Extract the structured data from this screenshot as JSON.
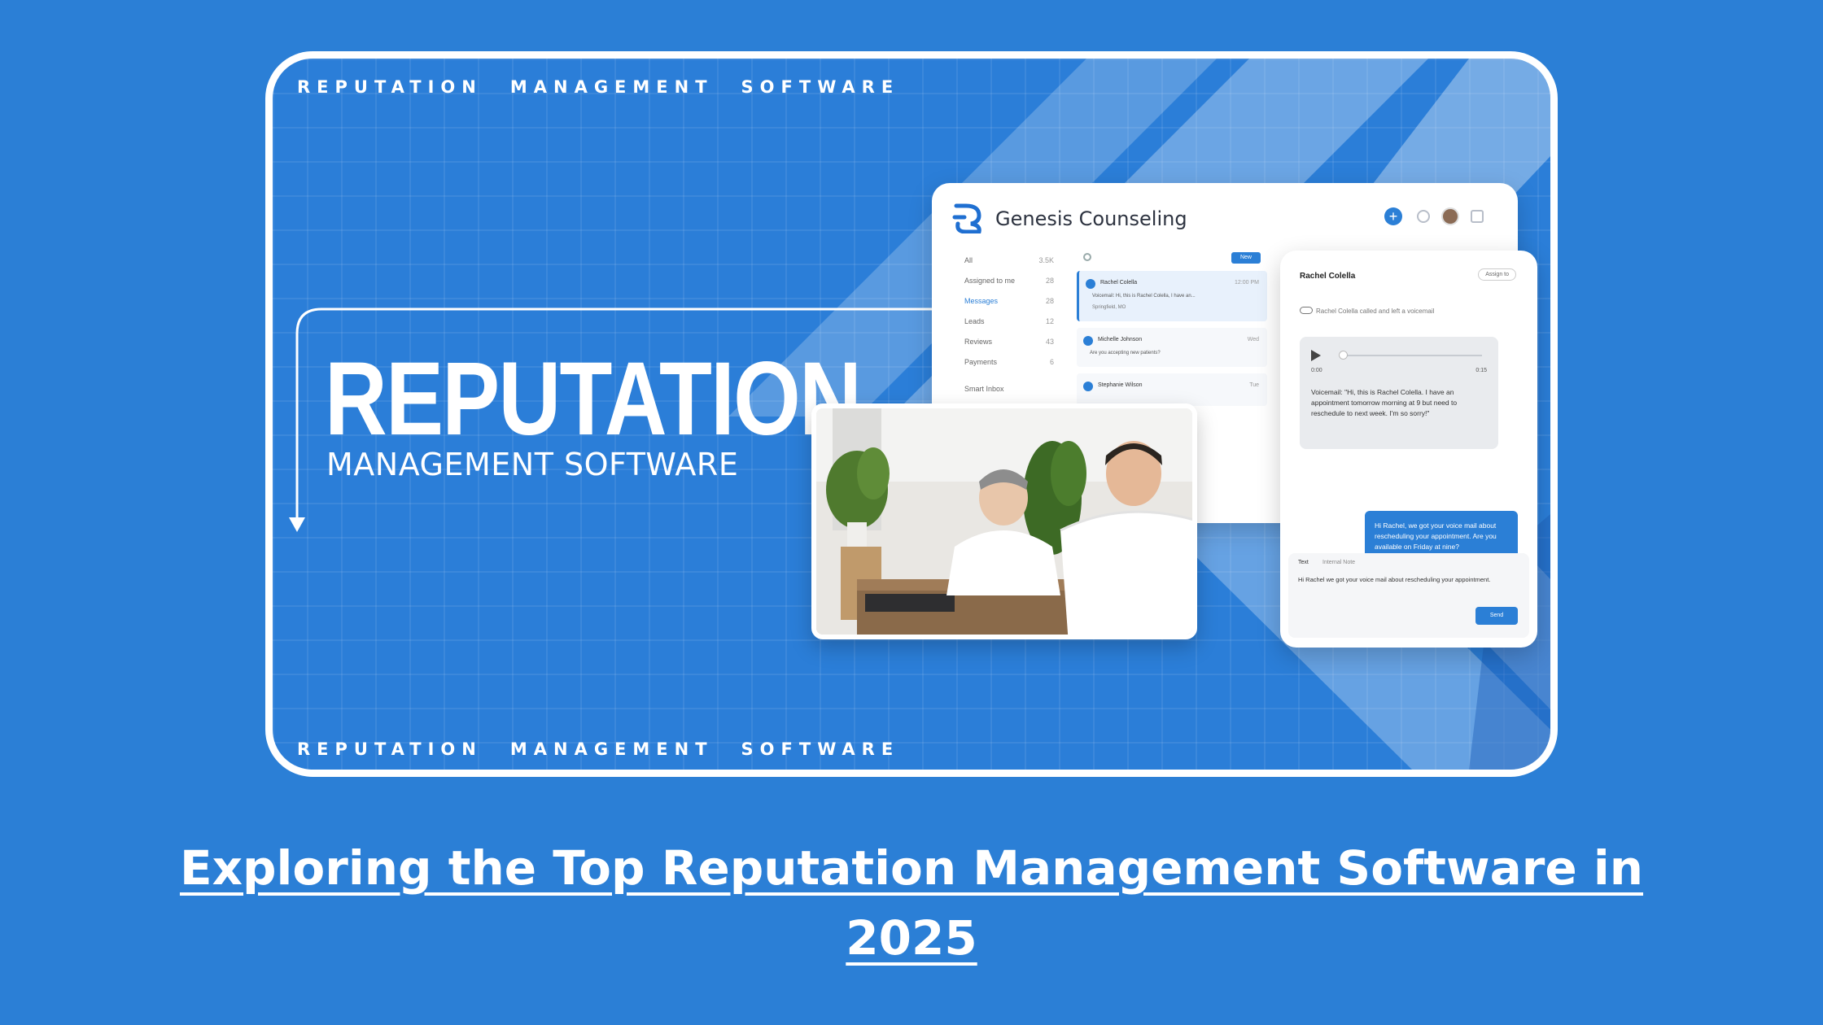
{
  "tagline": {
    "word1": "REPUTATION",
    "word2": "MANAGEMENT",
    "word3": "SOFTWARE"
  },
  "hero": {
    "title": "REPUTATION",
    "subtitle": "MANAGEMENT SOFTWARE"
  },
  "app": {
    "name": "Genesis Counseling",
    "nav": [
      {
        "label": "All",
        "count": "3.5K"
      },
      {
        "label": "Assigned to me",
        "count": "28"
      },
      {
        "label": "Messages",
        "count": "28"
      },
      {
        "label": "Leads",
        "count": "12"
      },
      {
        "label": "Reviews",
        "count": "43"
      },
      {
        "label": "Payments",
        "count": "6"
      },
      {
        "label": "Smart Inbox",
        "count": ""
      }
    ],
    "new_button": "New",
    "messages": [
      {
        "name": "Rachel Colella",
        "time": "12:00 PM",
        "preview": "Voicemail: Hi, this is Rachel Colella, I have an...",
        "location": "Springfield, MO"
      },
      {
        "name": "Michelle Johnson",
        "time": "Wed",
        "preview": "Are you accepting new patients?",
        "location": ""
      },
      {
        "name": "Stephanie Wilson",
        "time": "Tue",
        "preview": "",
        "location": ""
      }
    ]
  },
  "chat": {
    "contact_name": "Rachel Colella",
    "assign_label": "Assign to",
    "voicemail_note": "Rachel Colella called and left a voicemail",
    "audio_start": "0:00",
    "audio_end": "0:15",
    "voicemail_text": "Voicemail: \"Hi, this is Rachel Colella. I have an appointment tomorrow morning at 9 but need to reschedule to next week. I'm so sorry!\"",
    "reply_text": "Hi Rachel, we got your voice mail about rescheduling your appointment. Are you available on Friday at nine?",
    "composer_tab1": "Text",
    "composer_tab2": "Internal Note",
    "composer_text": "Hi Rachel we got your voice mail about rescheduling your appointment.",
    "send_label": "Send"
  },
  "caption": {
    "line1": "Exploring the Top Reputation Management Software in",
    "line2": "2025 "
  },
  "colors": {
    "background": "#2B7FD6",
    "accent": "#2B7FD6",
    "white": "#FFFFFF"
  }
}
